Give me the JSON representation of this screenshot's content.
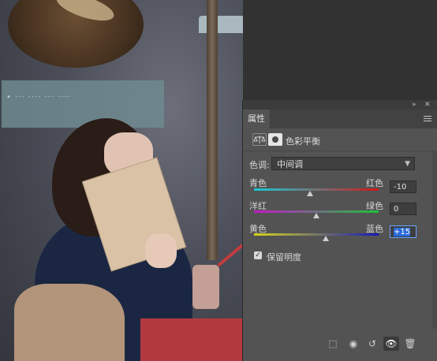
{
  "photo": {
    "sign_text": "• ··· ···· ··· ····"
  },
  "panel": {
    "tab_label": "属性",
    "title": "色彩平衡",
    "tone_label": "色调:",
    "tone_value": "中间调",
    "sliders": [
      {
        "left": "青色",
        "right": "红色",
        "value": "-10",
        "level": -10
      },
      {
        "left": "洋红",
        "right": "绿色",
        "value": "0",
        "level": 0
      },
      {
        "left": "黄色",
        "right": "蓝色",
        "value": "+15",
        "level": 15
      }
    ],
    "preserve_label": "保留明度",
    "preserve_checked": true
  },
  "icons": {
    "collapse": "double-chevron-right-icon",
    "close": "close-icon",
    "menu": "menu-icon",
    "balance": "balance-scale-icon",
    "mask": "mask-icon",
    "clip": "clip-to-layer-icon",
    "view_prev": "view-previous-state-icon",
    "reset": "reset-icon",
    "visibility": "eye-icon",
    "delete": "trash-icon"
  },
  "colors": {
    "panel_bg": "#535353",
    "active_blue": "#2b6ad8"
  }
}
